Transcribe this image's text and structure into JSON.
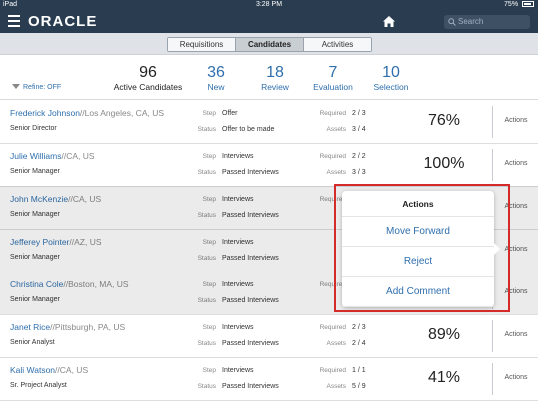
{
  "status_bar": {
    "device": "iPad",
    "time": "3:28 PM",
    "battery": "75%"
  },
  "app": {
    "brand": "ORACLE",
    "search_placeholder": "Search"
  },
  "tabs": [
    {
      "label": "Requisitions",
      "active": false
    },
    {
      "label": "Candidates",
      "active": true
    },
    {
      "label": "Activities",
      "active": false
    }
  ],
  "summary": {
    "refine": "Refine: OFF",
    "stats": [
      {
        "value": "96",
        "label": "Active Candidates"
      },
      {
        "value": "36",
        "label": "New"
      },
      {
        "value": "18",
        "label": "Review"
      },
      {
        "value": "7",
        "label": "Evaluation"
      },
      {
        "value": "10",
        "label": "Selection"
      }
    ]
  },
  "labels": {
    "step": "Step",
    "status": "Status",
    "required": "Required",
    "assets": "Assets",
    "actions": "Actions"
  },
  "candidates": [
    {
      "name": "Frederick Johnson",
      "location": "//Los Angeles, CA, US",
      "title": "Senior Director",
      "step": "Offer",
      "status": "Offer to be made",
      "required": "2 / 3",
      "assets": "3 / 4",
      "score": "76%"
    },
    {
      "name": "Julie Williams",
      "location": "//CA, US",
      "title": "Senior Manager",
      "step": "Interviews",
      "status": "Passed Interviews",
      "required": "2 / 2",
      "assets": "3 / 3",
      "score": "100%"
    },
    {
      "name": "John McKenzie",
      "location": "//CA, US",
      "title": "Senior Manager",
      "step": "Interviews",
      "status": "Passed Interviews",
      "required": "",
      "assets": "",
      "score": ""
    },
    {
      "name": "Jefferey Pointer",
      "location": "//AZ, US",
      "title": "Senior Manager",
      "step": "Interviews",
      "status": "Passed Interviews",
      "required": "",
      "assets": "",
      "score": ""
    },
    {
      "name": "Christina Cole",
      "location": "//Boston, MA, US",
      "title": "Senior Manager",
      "step": "Interviews",
      "status": "Passed Interviews",
      "required": "",
      "assets": "",
      "score": ""
    },
    {
      "name": "Janet Rice",
      "location": "//Pittsburgh, PA, US",
      "title": "Senior Analyst",
      "step": "Interviews",
      "status": "Passed Interviews",
      "required": "2 / 3",
      "assets": "2 / 4",
      "score": "89%"
    },
    {
      "name": "Kali Watson",
      "location": "//CA, US",
      "title": "Sr. Project Analyst",
      "step": "Interviews",
      "status": "Passed Interviews",
      "required": "1 / 1",
      "assets": "5 / 9",
      "score": "41%"
    }
  ],
  "actions_popover": {
    "title": "Actions",
    "items": [
      "Move Forward",
      "Reject",
      "Add Comment"
    ]
  }
}
